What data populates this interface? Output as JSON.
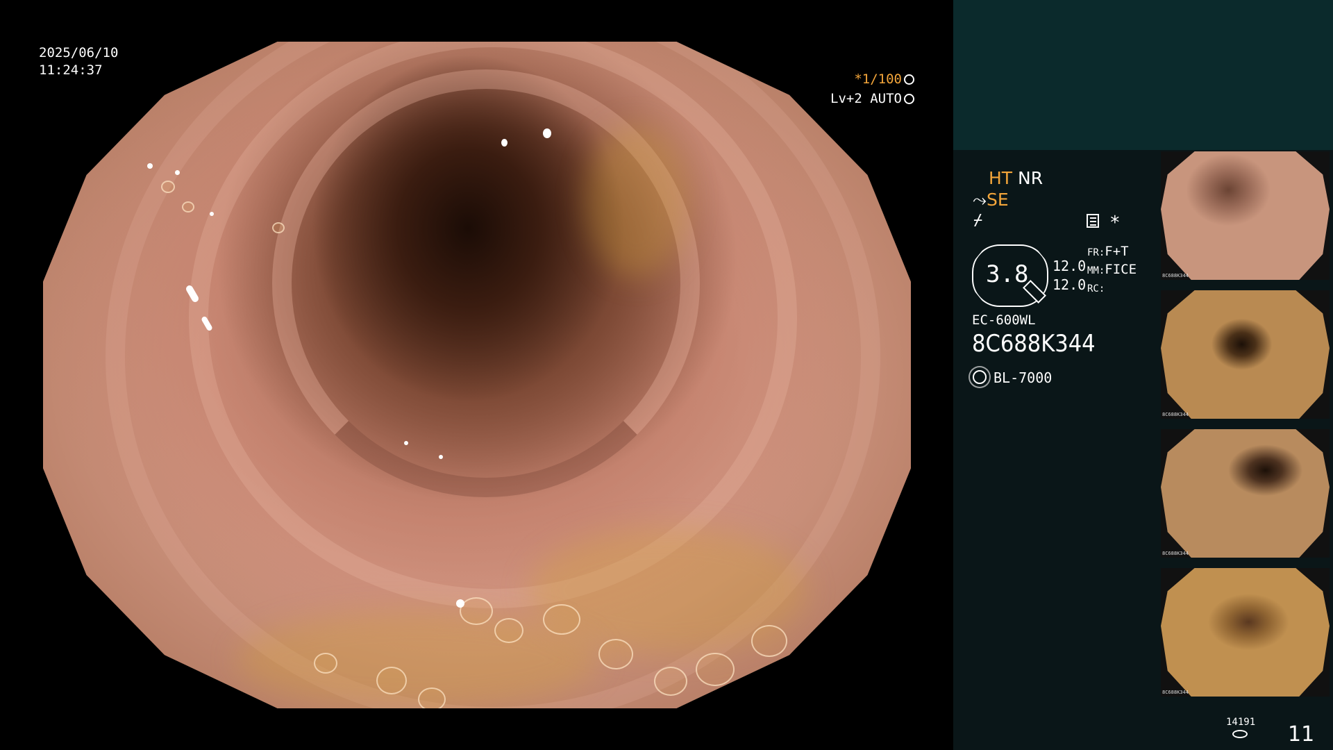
{
  "overlay": {
    "date": "2025/06/10",
    "time": "11:24:37",
    "shutter": "*1/100",
    "level": "Lv+2 AUTO"
  },
  "panel": {
    "ht": "HT",
    "nr": "NR",
    "se": "SE",
    "mode_value": "3.8",
    "values": [
      "12.0",
      "12.0"
    ],
    "labels": [
      {
        "key": "FR:",
        "value": "F+T"
      },
      {
        "key": "MM:",
        "value": "FICE"
      },
      {
        "key": "RC:",
        "value": ""
      }
    ],
    "scope_model": "EC-600WL",
    "scope_serial": "8C688K344",
    "light_source": "BL-7000",
    "storage_count": "14191",
    "image_count": "11"
  },
  "thumbnails": [
    {
      "caption": "8C688K344",
      "tone": "#c8957d"
    },
    {
      "caption": "8C688K344",
      "tone": "#b98a52"
    },
    {
      "caption": "8C688K344",
      "tone": "#b88b5e"
    },
    {
      "caption": "8C688K344",
      "tone": "#c09050"
    }
  ],
  "colors": {
    "accent_orange": "#f3a53a",
    "panel_bg": "#0a1618",
    "panel_top_bg": "#0b2a2c"
  }
}
